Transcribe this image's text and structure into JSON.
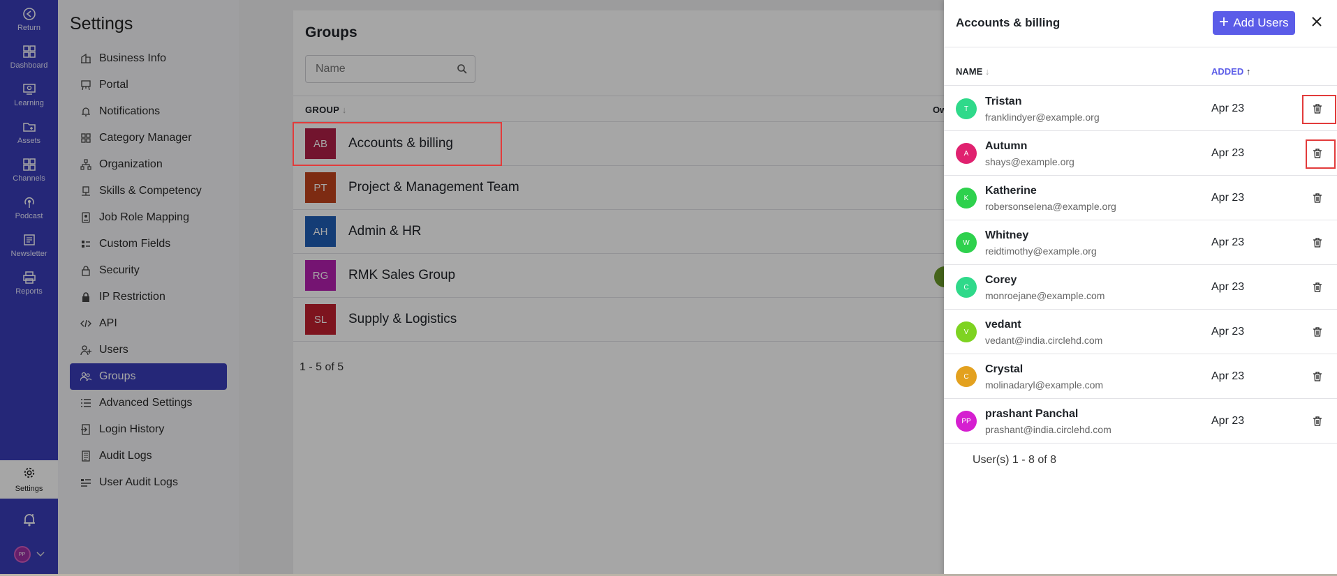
{
  "rail": {
    "items": [
      {
        "label": "Return",
        "icon": "return-icon"
      },
      {
        "label": "Dashboard",
        "icon": "dashboard-icon"
      },
      {
        "label": "Learning",
        "icon": "learning-icon"
      },
      {
        "label": "Assets",
        "icon": "assets-icon"
      },
      {
        "label": "Channels",
        "icon": "channels-icon"
      },
      {
        "label": "Podcast",
        "icon": "podcast-icon"
      },
      {
        "label": "Newsletter",
        "icon": "newsletter-icon"
      },
      {
        "label": "Reports",
        "icon": "reports-icon"
      }
    ],
    "settings_label": "Settings",
    "avatar_initials": "PP"
  },
  "menu": {
    "title": "Settings",
    "items": [
      {
        "label": "Business Info",
        "icon": "business-icon"
      },
      {
        "label": "Portal",
        "icon": "portal-icon"
      },
      {
        "label": "Notifications",
        "icon": "bell-icon"
      },
      {
        "label": "Category Manager",
        "icon": "grid-icon"
      },
      {
        "label": "Organization",
        "icon": "org-icon"
      },
      {
        "label": "Skills & Competency",
        "icon": "skills-icon"
      },
      {
        "label": "Job Role Mapping",
        "icon": "badge-icon"
      },
      {
        "label": "Custom Fields",
        "icon": "fields-icon"
      },
      {
        "label": "Security",
        "icon": "lock-open-icon"
      },
      {
        "label": "IP Restriction",
        "icon": "lock-icon"
      },
      {
        "label": "API",
        "icon": "code-icon"
      },
      {
        "label": "Users",
        "icon": "user-add-icon"
      },
      {
        "label": "Groups",
        "icon": "users-icon"
      },
      {
        "label": "Advanced Settings",
        "icon": "list-icon"
      },
      {
        "label": "Login History",
        "icon": "login-icon"
      },
      {
        "label": "Audit Logs",
        "icon": "audit-icon"
      },
      {
        "label": "User Audit Logs",
        "icon": "user-audit-icon"
      }
    ],
    "active": "Groups"
  },
  "groups": {
    "title": "Groups",
    "search_placeholder": "Name",
    "col_group": "GROUP",
    "col_owner": "Ow",
    "rows": [
      {
        "initials": "AB",
        "name": "Accounts & billing",
        "color": "#b01f47"
      },
      {
        "initials": "PT",
        "name": "Project & Management Team",
        "color": "#c0431c"
      },
      {
        "initials": "AH",
        "name": "Admin & HR",
        "color": "#1f5fb6"
      },
      {
        "initials": "RG",
        "name": "RMK Sales Group",
        "color": "#b420b0"
      },
      {
        "initials": "SL",
        "name": "Supply & Logistics",
        "color": "#c01f2e"
      }
    ],
    "footer": "1 - 5 of 5"
  },
  "drawer": {
    "title": "Accounts & billing",
    "add_label": "Add Users",
    "col_name": "NAME",
    "col_added": "ADDED",
    "users": [
      {
        "initial": "T",
        "name": "Tristan",
        "email": "franklindyer@example.org",
        "added": "Apr 23",
        "color": "#2fd98a"
      },
      {
        "initial": "A",
        "name": "Autumn",
        "email": "shays@example.org",
        "added": "Apr 23",
        "color": "#e0216f"
      },
      {
        "initial": "K",
        "name": "Katherine",
        "email": "robersonselena@example.org",
        "added": "Apr 23",
        "color": "#2ed14d"
      },
      {
        "initial": "W",
        "name": "Whitney",
        "email": "reidtimothy@example.org",
        "added": "Apr 23",
        "color": "#2ed14d"
      },
      {
        "initial": "C",
        "name": "Corey",
        "email": "monroejane@example.com",
        "added": "Apr 23",
        "color": "#2fd98a"
      },
      {
        "initial": "V",
        "name": "vedant",
        "email": "vedant@india.circlehd.com",
        "added": "Apr 23",
        "color": "#7ed321"
      },
      {
        "initial": "C",
        "name": "Crystal",
        "email": "molinadaryl@example.com",
        "added": "Apr 23",
        "color": "#e3a11f"
      },
      {
        "initial": "PP",
        "name": "prashant Panchal",
        "email": "prashant@india.circlehd.com",
        "added": "Apr 23",
        "color": "#d51fd0"
      }
    ],
    "footer": "User(s) 1 - 8 of 8"
  }
}
